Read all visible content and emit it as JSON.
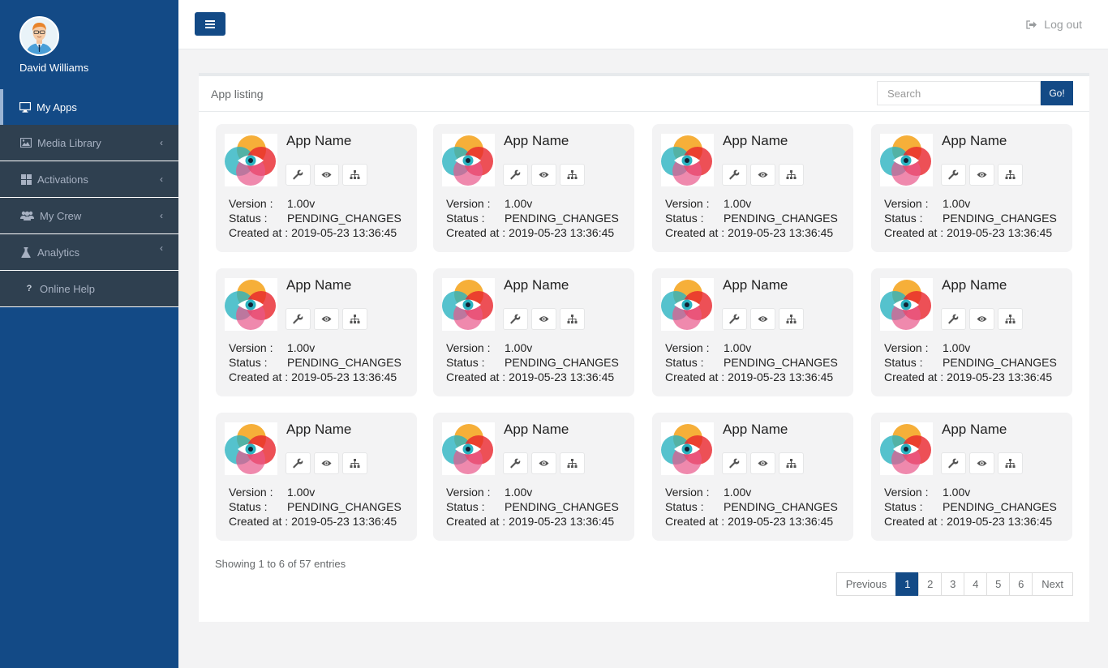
{
  "user": {
    "name": "David Williams"
  },
  "sidebar": {
    "items": [
      {
        "label": "My Apps",
        "icon": "monitor-icon"
      },
      {
        "label": "Media Library",
        "icon": "image-icon"
      },
      {
        "label": "Activations",
        "icon": "grid-icon"
      },
      {
        "label": "My Crew",
        "icon": "users-icon"
      },
      {
        "label": "Analytics",
        "icon": "flask-icon"
      },
      {
        "label": "Online Help",
        "icon": "question-icon"
      }
    ]
  },
  "header": {
    "logout_label": "Log out"
  },
  "panel": {
    "title": "App listing",
    "search_placeholder": "Search",
    "go_label": "Go!"
  },
  "labels": {
    "version": "Version :",
    "status": "Status :",
    "created": "Created at :"
  },
  "apps": [
    {
      "name": "App Name",
      "version": "1.00v",
      "status": "PENDING_CHANGES",
      "created": "2019-05-23 13:36:45"
    },
    {
      "name": "App Name",
      "version": "1.00v",
      "status": "PENDING_CHANGES",
      "created": "2019-05-23 13:36:45"
    },
    {
      "name": "App Name",
      "version": "1.00v",
      "status": "PENDING_CHANGES",
      "created": "2019-05-23 13:36:45"
    },
    {
      "name": "App Name",
      "version": "1.00v",
      "status": "PENDING_CHANGES",
      "created": "2019-05-23 13:36:45"
    },
    {
      "name": "App Name",
      "version": "1.00v",
      "status": "PENDING_CHANGES",
      "created": "2019-05-23 13:36:45"
    },
    {
      "name": "App Name",
      "version": "1.00v",
      "status": "PENDING_CHANGES",
      "created": "2019-05-23 13:36:45"
    },
    {
      "name": "App Name",
      "version": "1.00v",
      "status": "PENDING_CHANGES",
      "created": "2019-05-23 13:36:45"
    },
    {
      "name": "App Name",
      "version": "1.00v",
      "status": "PENDING_CHANGES",
      "created": "2019-05-23 13:36:45"
    },
    {
      "name": "App Name",
      "version": "1.00v",
      "status": "PENDING_CHANGES",
      "created": "2019-05-23 13:36:45"
    },
    {
      "name": "App Name",
      "version": "1.00v",
      "status": "PENDING_CHANGES",
      "created": "2019-05-23 13:36:45"
    },
    {
      "name": "App Name",
      "version": "1.00v",
      "status": "PENDING_CHANGES",
      "created": "2019-05-23 13:36:45"
    },
    {
      "name": "App Name",
      "version": "1.00v",
      "status": "PENDING_CHANGES",
      "created": "2019-05-23 13:36:45"
    }
  ],
  "footer": {
    "showing": "Showing 1 to 6 of 57 entries",
    "pagination": {
      "previous": "Previous",
      "pages": [
        "1",
        "2",
        "3",
        "4",
        "5",
        "6"
      ],
      "current": "1",
      "next": "Next"
    }
  },
  "colors": {
    "brand": "#134a86",
    "sidebar_item": "#2f4050",
    "card_bg": "#f3f3f4"
  }
}
